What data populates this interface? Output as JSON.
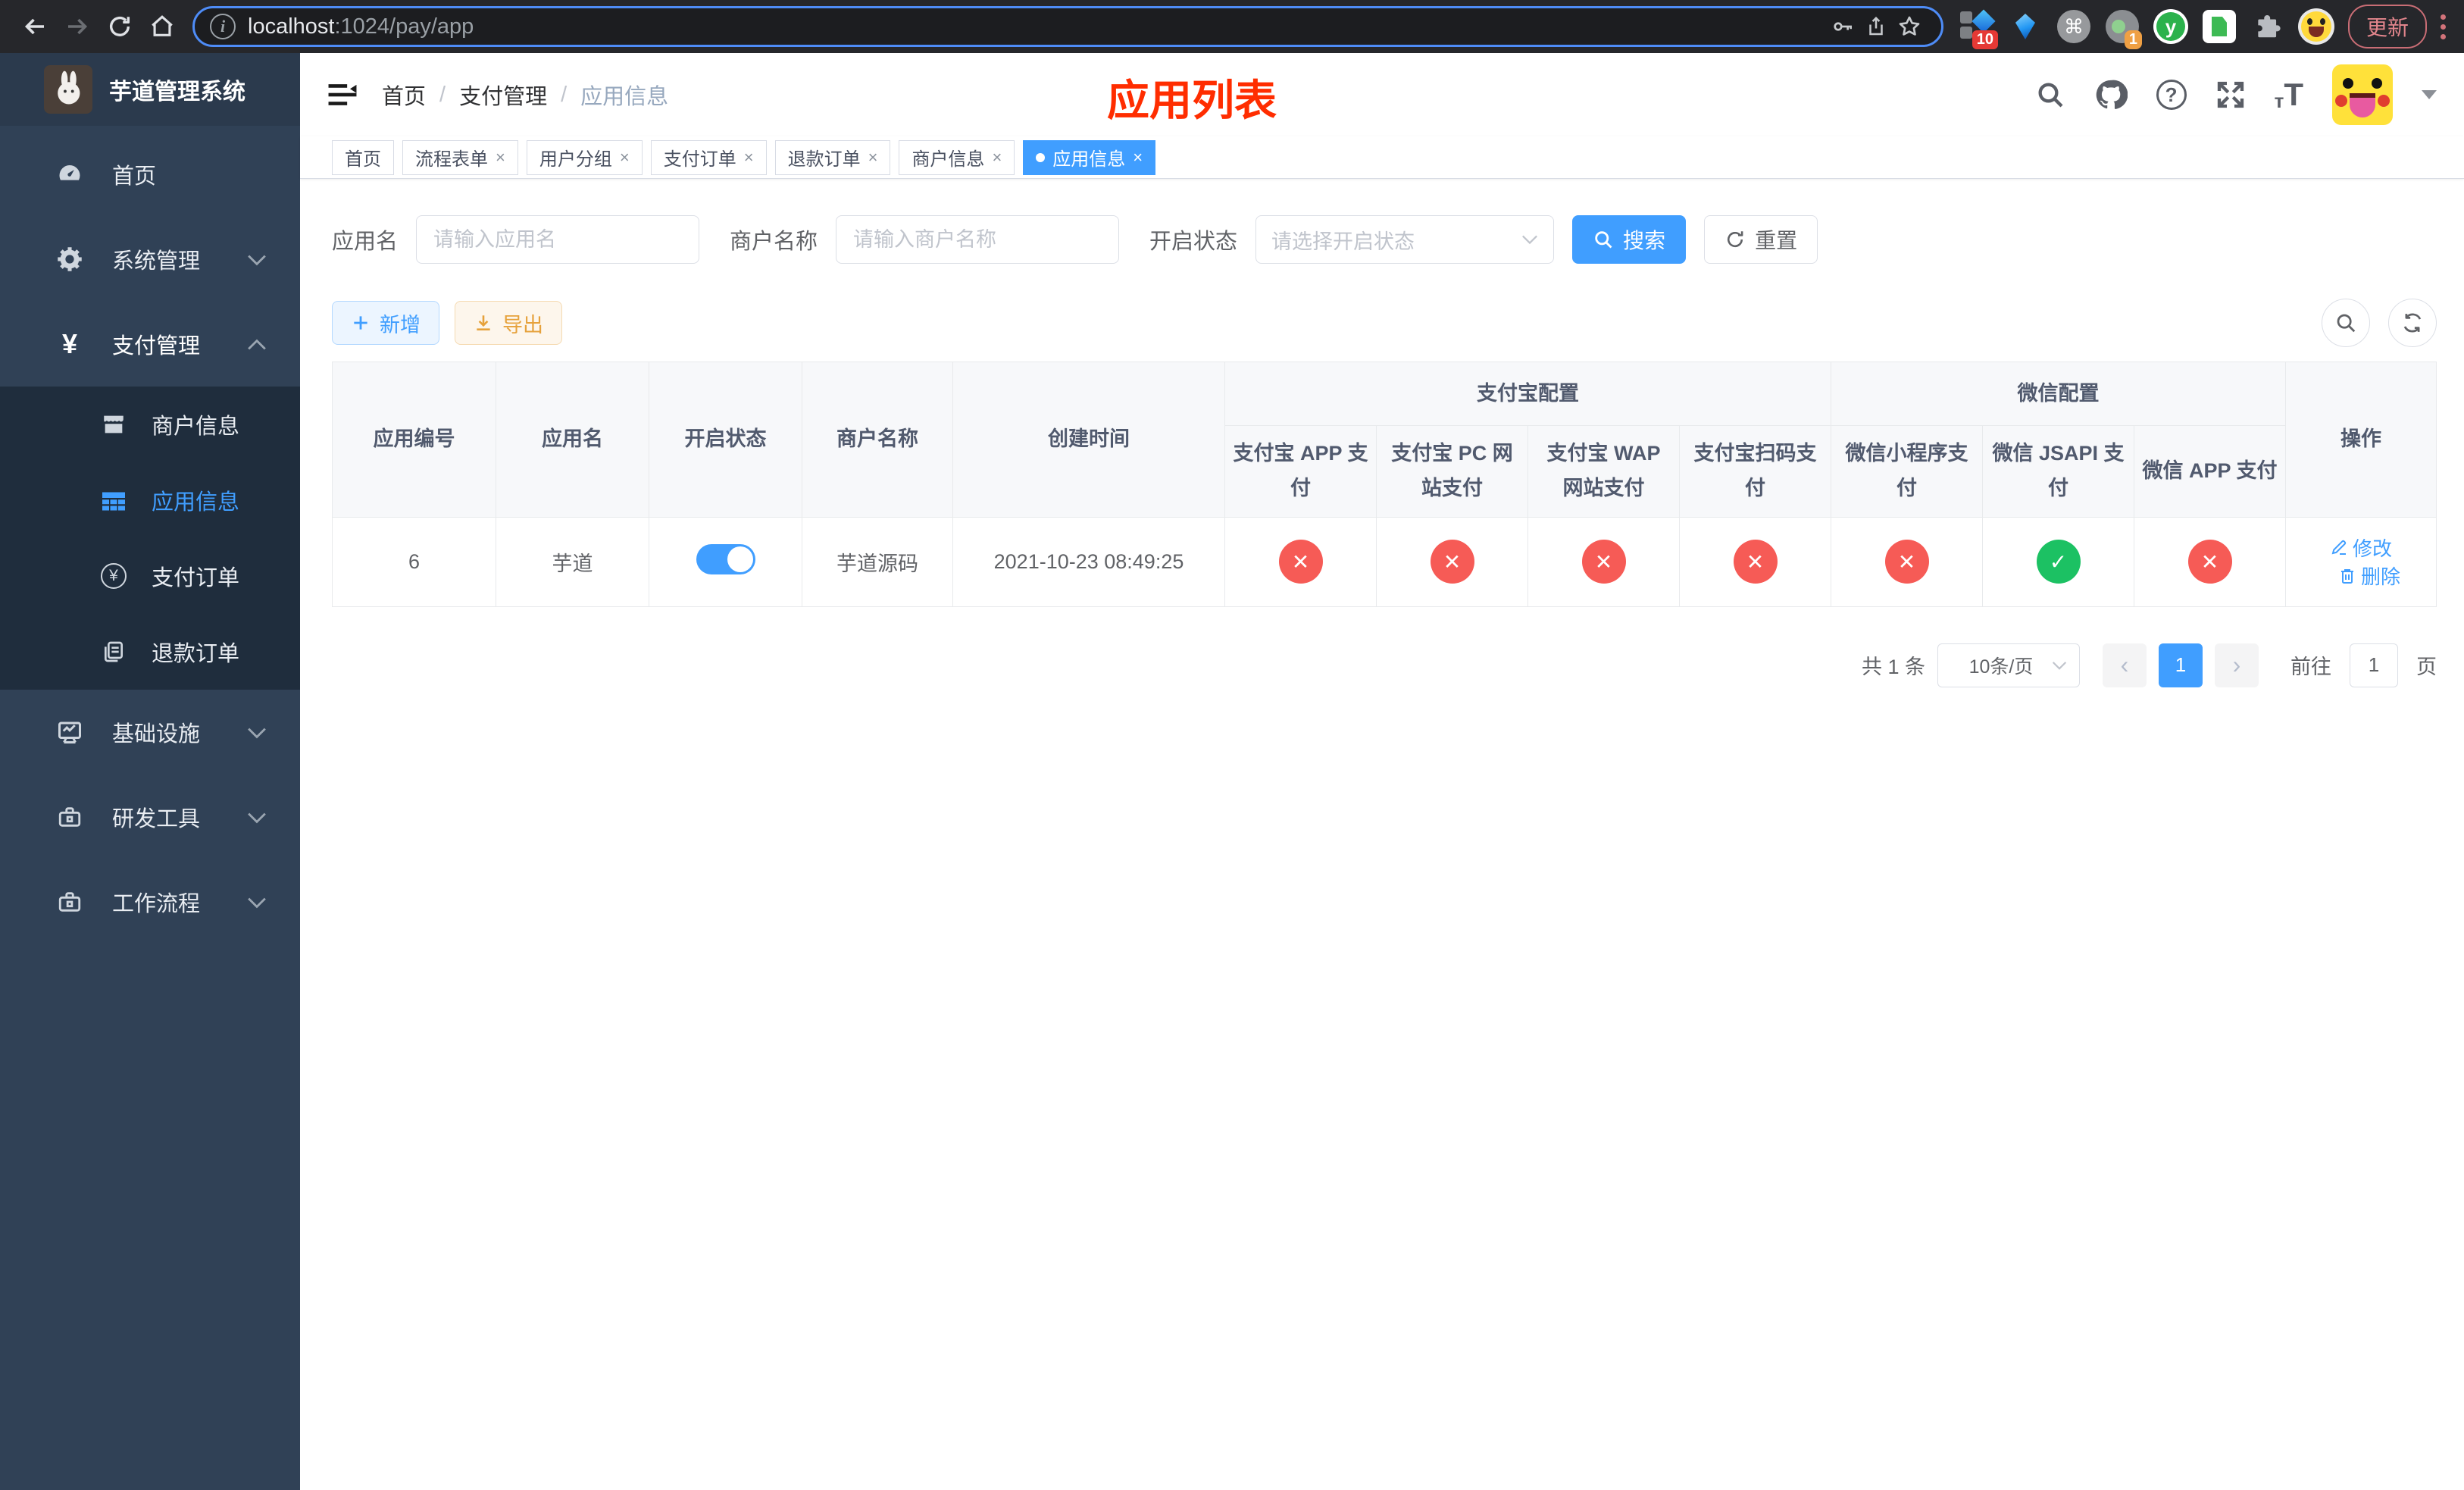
{
  "browser": {
    "url_host": "localhost",
    "url_path": ":1024/pay/app",
    "update_label": "更新",
    "ext_badge_10": "10",
    "ext_badge_1": "1",
    "ext_y_label": "y"
  },
  "sidebar": {
    "title": "芋道管理系统",
    "menu": [
      {
        "label": "首页"
      },
      {
        "label": "系统管理"
      },
      {
        "label": "支付管理"
      },
      {
        "label": "商户信息"
      },
      {
        "label": "应用信息"
      },
      {
        "label": "支付订单"
      },
      {
        "label": "退款订单"
      },
      {
        "label": "基础设施"
      },
      {
        "label": "研发工具"
      },
      {
        "label": "工作流程"
      }
    ]
  },
  "navbar": {
    "breadcrumb": {
      "home": "首页",
      "section": "支付管理",
      "current": "应用信息",
      "separator": "/"
    },
    "annotation": "应用列表"
  },
  "tabs": [
    {
      "label": "首页"
    },
    {
      "label": "流程表单"
    },
    {
      "label": "用户分组"
    },
    {
      "label": "支付订单"
    },
    {
      "label": "退款订单"
    },
    {
      "label": "商户信息"
    },
    {
      "label": "应用信息"
    }
  ],
  "filters": {
    "app_name": {
      "label": "应用名",
      "placeholder": "请输入应用名"
    },
    "merchant_name": {
      "label": "商户名称",
      "placeholder": "请输入商户名称"
    },
    "status": {
      "label": "开启状态",
      "placeholder": "请选择开启状态"
    },
    "search_label": "搜索",
    "reset_label": "重置"
  },
  "toolbar": {
    "add_label": "新增",
    "export_label": "导出"
  },
  "table": {
    "headers": {
      "app_id": "应用编号",
      "app_name": "应用名",
      "status": "开启状态",
      "merchant": "商户名称",
      "created": "创建时间",
      "alipay_group": "支付宝配置",
      "wechat_group": "微信配置",
      "alipay_app": "支付宝 APP 支付",
      "alipay_pc": "支付宝 PC 网站支付",
      "alipay_wap": "支付宝 WAP 网站支付",
      "alipay_qr": "支付宝扫码支付",
      "wechat_lite": "微信小程序支付",
      "wechat_jsapi": "微信 JSAPI 支付",
      "wechat_app": "微信 APP 支付",
      "actions": "操作"
    },
    "row": {
      "app_id": "6",
      "app_name": "芋道",
      "enabled": true,
      "merchant": "芋道源码",
      "created": "2021-10-23 08:49:25",
      "alipay_app": "error",
      "alipay_pc": "error",
      "alipay_wap": "error",
      "alipay_qr": "error",
      "wechat_lite": "error",
      "wechat_jsapi": "success",
      "wechat_app": "error",
      "edit_label": "修改",
      "delete_label": "删除"
    }
  },
  "pagination": {
    "total": "共 1 条",
    "page_size": "10条/页",
    "page": "1",
    "goto_label": "前往",
    "goto_value": "1",
    "unit_label": "页"
  },
  "glyphs": {
    "check": "✓",
    "cross": "✕",
    "tag_close": "×",
    "yuan": "¥",
    "command": "⌘",
    "arrow_left": "‹",
    "arrow_right": "›"
  }
}
